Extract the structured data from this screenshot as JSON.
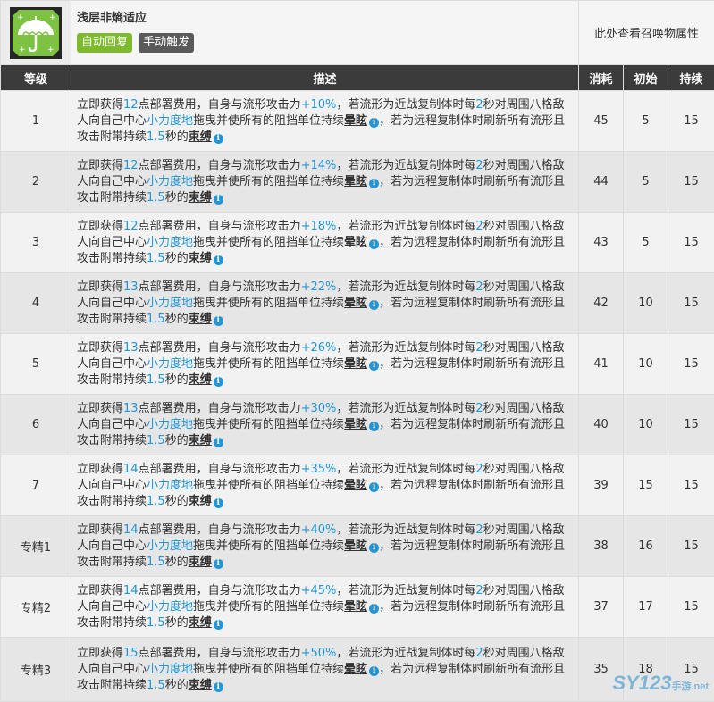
{
  "header": {
    "skill_name": "浅层非熵适应",
    "tag_auto": "自动回复",
    "tag_manual": "手动触发",
    "summon_link": "此处查看召唤物属性",
    "icon": "umbrella-skill-icon"
  },
  "columns": {
    "level": "等级",
    "description": "描述",
    "cost": "消耗",
    "initial": "初始",
    "duration": "持续"
  },
  "desc_text": {
    "p1": "立即获得",
    "p2": "点部署费用，自身与流形攻击力",
    "p3": "，若流形为近战复制体时每",
    "p4": "2",
    "p5": "秒对周围八格敌人向自己中心",
    "p6": "小力度地",
    "p7": "拖曳并使所有的阻挡单位持续",
    "p8": "晕眩",
    "p9": "，若为远程复制体时刷新所有流形且攻击附带持续",
    "p10": "1.5",
    "p11": "秒的",
    "p12": "束缚",
    "info_glyph": "i"
  },
  "rows": [
    {
      "level": "1",
      "dp": "12",
      "atk": "+10%",
      "cost": "45",
      "initial": "5",
      "duration": "15"
    },
    {
      "level": "2",
      "dp": "12",
      "atk": "+14%",
      "cost": "44",
      "initial": "5",
      "duration": "15"
    },
    {
      "level": "3",
      "dp": "12",
      "atk": "+18%",
      "cost": "43",
      "initial": "5",
      "duration": "15"
    },
    {
      "level": "4",
      "dp": "13",
      "atk": "+22%",
      "cost": "42",
      "initial": "10",
      "duration": "15"
    },
    {
      "level": "5",
      "dp": "13",
      "atk": "+26%",
      "cost": "41",
      "initial": "10",
      "duration": "15"
    },
    {
      "level": "6",
      "dp": "13",
      "atk": "+30%",
      "cost": "40",
      "initial": "10",
      "duration": "15"
    },
    {
      "level": "7",
      "dp": "14",
      "atk": "+35%",
      "cost": "39",
      "initial": "15",
      "duration": "15"
    },
    {
      "level": "专精1",
      "dp": "14",
      "atk": "+40%",
      "cost": "38",
      "initial": "16",
      "duration": "15"
    },
    {
      "level": "专精2",
      "dp": "14",
      "atk": "+45%",
      "cost": "37",
      "initial": "17",
      "duration": "15"
    },
    {
      "level": "专精3",
      "dp": "15",
      "atk": "+50%",
      "cost": "35",
      "initial": "18",
      "duration": "15"
    }
  ],
  "watermark": {
    "brand": "SY123",
    "sub": "手游",
    "domain": ".net"
  },
  "colors": {
    "header_bg": "#3b3b3b",
    "highlight_blue": "#2196d6",
    "tag_green": "#7dbb2c",
    "tag_gray": "#5a5a5a",
    "icon_green": "#7dc242"
  }
}
